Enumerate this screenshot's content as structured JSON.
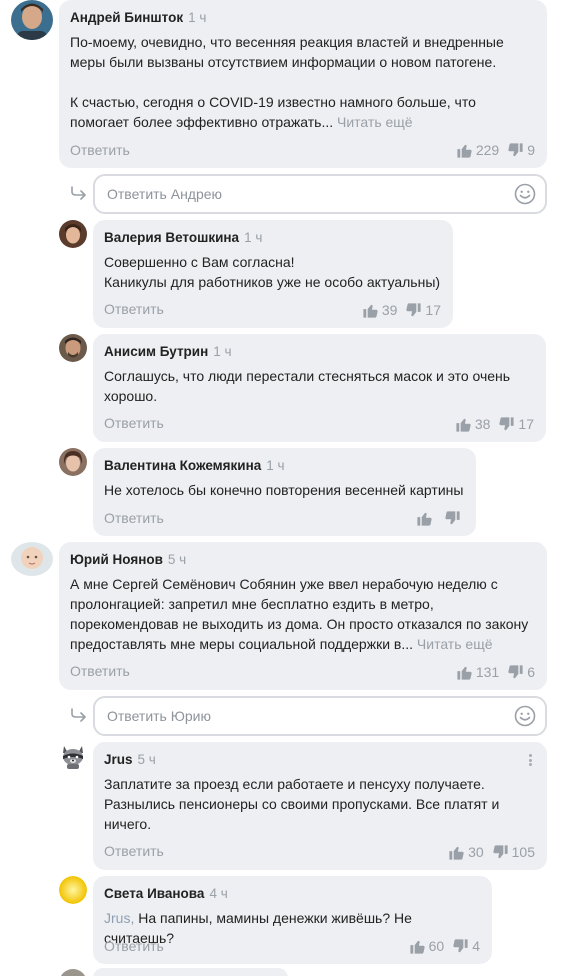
{
  "comments": [
    {
      "author": "Андрей Биншток",
      "time": "1 ч",
      "paragraphs": [
        "По-моему, очевидно, что весенняя реакция властей и внедренные меры были вызваны отсутствием информации о новом патогене.",
        "К счастью, сегодня о COVID-19 известно намного больше, что помогает более эффективно отражать..."
      ],
      "read_more": "Читать ещё",
      "reply_label": "Ответить",
      "likes": "229",
      "dislikes": "9",
      "avatar_icon": "avatar-man-icon"
    },
    {
      "author": "Валерия Ветошкина",
      "time": "1 ч",
      "paragraphs": [
        "Совершенно с Вам согласна!",
        "Каникулы для работников уже не особо актуальны)"
      ],
      "reply_label": "Ответить",
      "likes": "39",
      "dislikes": "17",
      "avatar_icon": "avatar-woman-icon"
    },
    {
      "author": "Анисим Бутрин",
      "time": "1 ч",
      "paragraphs": [
        "Соглашусь, что люди перестали стесняться масок и это очень хорошо."
      ],
      "reply_label": "Ответить",
      "likes": "38",
      "dislikes": "17",
      "avatar_icon": "avatar-man-icon"
    },
    {
      "author": "Валентина Кожемякина",
      "time": "1 ч",
      "paragraphs": [
        "Не хотелось бы конечно повторения весенней картины"
      ],
      "reply_label": "Ответить",
      "likes": "",
      "dislikes": "",
      "avatar_icon": "avatar-woman-icon"
    },
    {
      "author": "Юрий Ноянов",
      "time": "5 ч",
      "paragraphs": [
        "А мне Сергей Семёнович Собянин уже ввел нерабочую неделю с пролонгацией:  запретил мне бесплатно ездить в метро, порекомендовав не выходить из дома. Он просто отказался по закону предоставлять мне меры социальной поддержки в..."
      ],
      "read_more": "Читать ещё",
      "reply_label": "Ответить",
      "likes": "131",
      "dislikes": "6",
      "avatar_icon": "avatar-baby-icon"
    },
    {
      "author": "Jrus",
      "time": "5 ч",
      "paragraphs": [
        "Заплатите за проезд если работаете и пенсуху получаете. Разнылись пенсионеры  со своими пропусками. Все платят и ничего."
      ],
      "reply_label": "Ответить",
      "likes": "30",
      "dislikes": "105",
      "avatar_icon": "avatar-raccoon-icon"
    },
    {
      "author": "Света Иванова",
      "time": "4 ч",
      "mention": "Jrus,",
      "paragraphs": [
        "На папины, мамины денежки живёшь? Не считаешь?"
      ],
      "reply_label": "Ответить",
      "likes": "60",
      "dislikes": "4",
      "avatar_icon": "avatar-sun-icon"
    }
  ],
  "reply_boxes": [
    {
      "placeholder": "Ответить Андрею"
    },
    {
      "placeholder": "Ответить Юрию"
    }
  ],
  "colors": {
    "bubble": "#eeeff2",
    "muted": "#9aa0a8",
    "text": "#222222",
    "mention": "#8f9fb3",
    "border": "#d9dbe0"
  }
}
